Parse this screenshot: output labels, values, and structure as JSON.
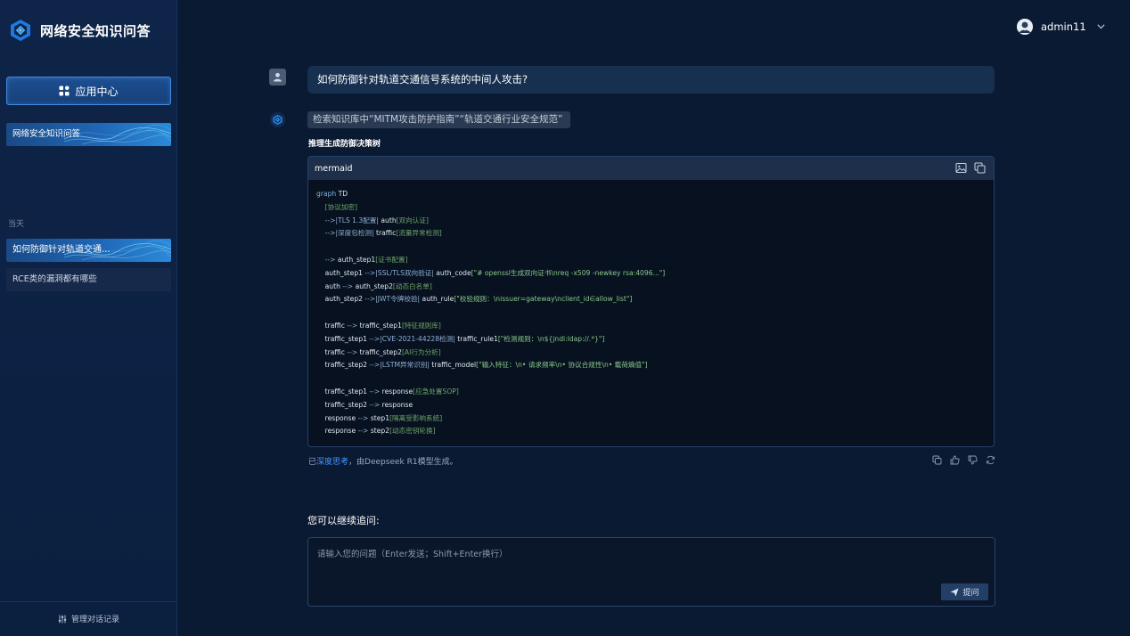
{
  "app": {
    "title": "网络安全知识问答"
  },
  "sidebar": {
    "app_center_label": "应用中心",
    "nav_active_label": "网络安全知识问答",
    "section_today": "当天",
    "history": [
      {
        "label": "如何防御针对轨道交通..."
      },
      {
        "label": "RCE类的漏洞都有哪些"
      }
    ],
    "manage_label": "管理对话记录"
  },
  "header": {
    "username": "admin11"
  },
  "chat": {
    "question": "如何防御针对轨道交通信号系统的中间人攻击?",
    "search_chip": "检索知识库中“MITM攻击防护指南”“轨道交通行业安全规范”",
    "section_heading": "推理生成防御决策树",
    "code_lang": "mermaid",
    "code_lines": [
      "graph TD",
      "    [协议加密]",
      "    -->|TLS 1.3配置| auth[双向认证]",
      "    -->|深度包检测| traffic[流量异常检测]",
      "",
      "    --> auth_step1[证书配置]",
      "    auth_step1 -->|SSL/TLS双向验证| auth_code[\"# openssl生成双向证书\\nreq -x509 -newkey rsa:4096...\"]",
      "    auth --> auth_step2[动态白名单]",
      "    auth_step2 -->|JWT令牌校验| auth_rule[\"校验规则：\\nissuer=gateway\\nclient_id∈allow_list\"]",
      "",
      "    traffic --> traffic_step1[特征规则库]",
      "    traffic_step1 -->|CVE-2021-44228检测| traffic_rule1[\"检测规则：\\n${jndi:ldap://.*}\"]",
      "    traffic --> traffic_step2[AI行为分析]",
      "    traffic_step2 -->|LSTM异常识别| traffic_model[\"输入特征：\\n• 请求频率\\n• 协议合规性\\n• 载荷熵值\"]",
      "",
      "    traffic_step1 --> response[应急处置SOP]",
      "    traffic_step2 --> response",
      "    response --> step1[隔离受影响系统]",
      "    response --> step2[动态密钥轮换]"
    ],
    "gen_note_prefix": "已",
    "gen_note_link": "深度思考",
    "gen_note_suffix": "，由Deepseek R1模型生成。",
    "follow_up_title": "您可以继续追问:",
    "input_placeholder": "请输入您的问题（Enter发送；Shift+Enter换行）",
    "ask_label": "提问"
  },
  "icons": {
    "brand": "brand-logo-icon",
    "app_center": "grid-icon",
    "manage": "sliders-icon",
    "user": "user-icon",
    "bot": "bot-icon",
    "image": "image-icon",
    "copy": "copy-icon",
    "thumbs_up": "thumbs-up-icon",
    "thumbs_down": "thumbs-down-icon",
    "refresh": "refresh-icon",
    "send": "send-icon",
    "chevron": "chevron-down-icon"
  },
  "colors": {
    "background": "#0b1a33",
    "sidebar": "#0e2448",
    "accent": "#3f96ff",
    "bubble": "#17304f",
    "code_bg": "#07111f"
  }
}
